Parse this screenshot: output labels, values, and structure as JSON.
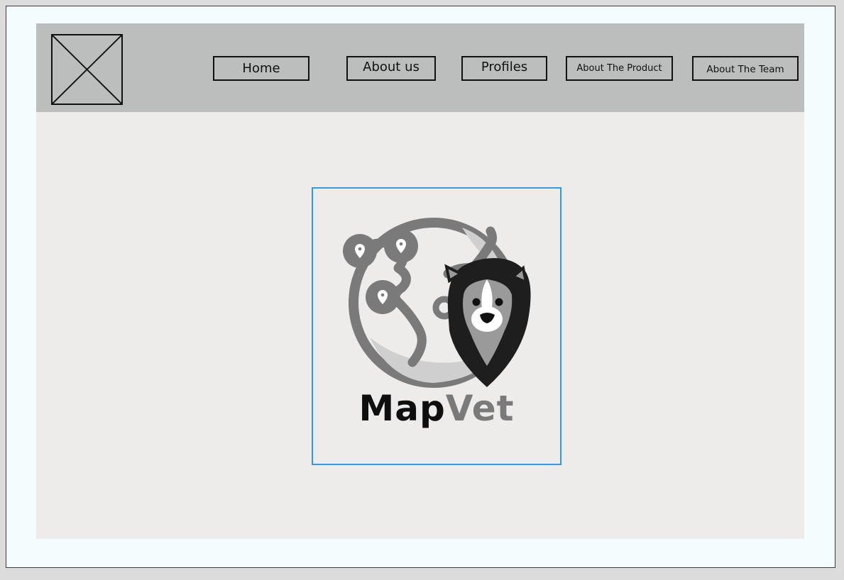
{
  "header": {
    "logo_placeholder_icon": "image-placeholder-icon",
    "nav": [
      {
        "id": "home",
        "label": "Home"
      },
      {
        "id": "about",
        "label": "About us"
      },
      {
        "id": "profiles",
        "label": "Profiles"
      },
      {
        "id": "product",
        "label": "About The Product"
      },
      {
        "id": "team",
        "label": "About The Team"
      }
    ]
  },
  "hero": {
    "logo_icon": "globe-dog-map-pin-icon",
    "brand_part1": "Map",
    "brand_part2": "Vet",
    "paw_icon": "paw-icon"
  },
  "colors": {
    "background": "#f4fdfd",
    "page": "#edecea",
    "header": "#bcbebd",
    "selection_border": "#2e9be6",
    "logo_gray": "#7a7a7a",
    "logo_dark": "#1c1c1c"
  }
}
